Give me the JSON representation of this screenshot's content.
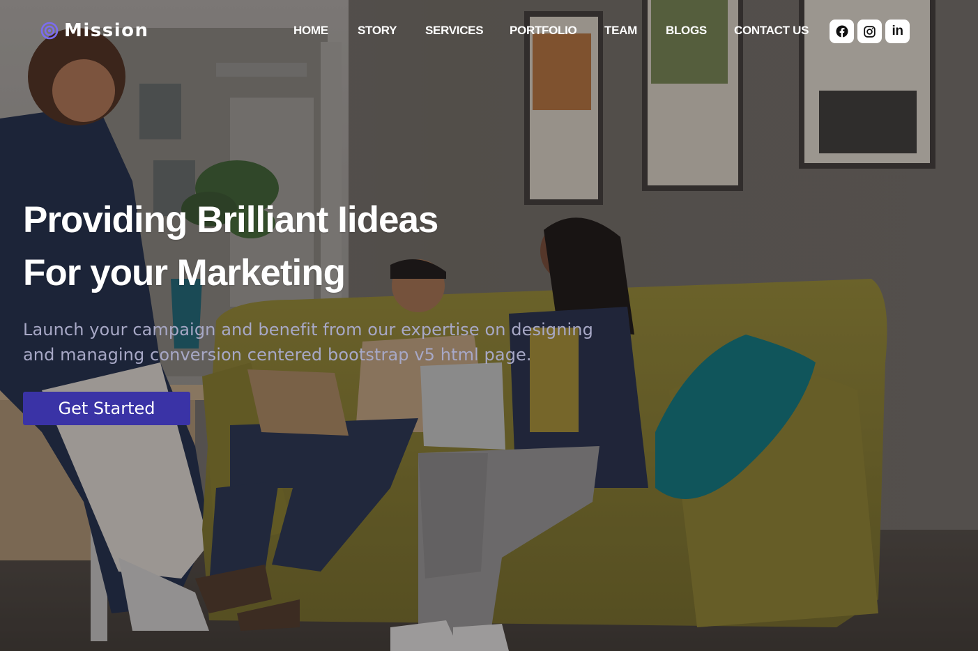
{
  "brand": {
    "name": "Mission",
    "accent_color": "#7b6cf0",
    "icon": "target-icon"
  },
  "nav": {
    "items": [
      {
        "label": "HOME"
      },
      {
        "label": "STORY"
      },
      {
        "label": "SERVICES"
      },
      {
        "label": "PORTFOLIO"
      },
      {
        "label": "TEAM"
      },
      {
        "label": "BLOGS"
      },
      {
        "label": "CONTACT US"
      }
    ]
  },
  "socials": [
    {
      "icon": "facebook-icon"
    },
    {
      "icon": "instagram-icon"
    },
    {
      "icon": "linkedin-icon",
      "text": "in"
    }
  ],
  "hero": {
    "headline_line1": "Providing Brilliant Iideas",
    "headline_line2": "For your Marketing",
    "subtext": "Launch your campaign and benefit from our expertise on designing and managing conversion centered bootstrap v5 html page.",
    "cta_label": "Get Started",
    "cta_color": "#3a33a6",
    "subtext_color": "#a7a8c6"
  }
}
